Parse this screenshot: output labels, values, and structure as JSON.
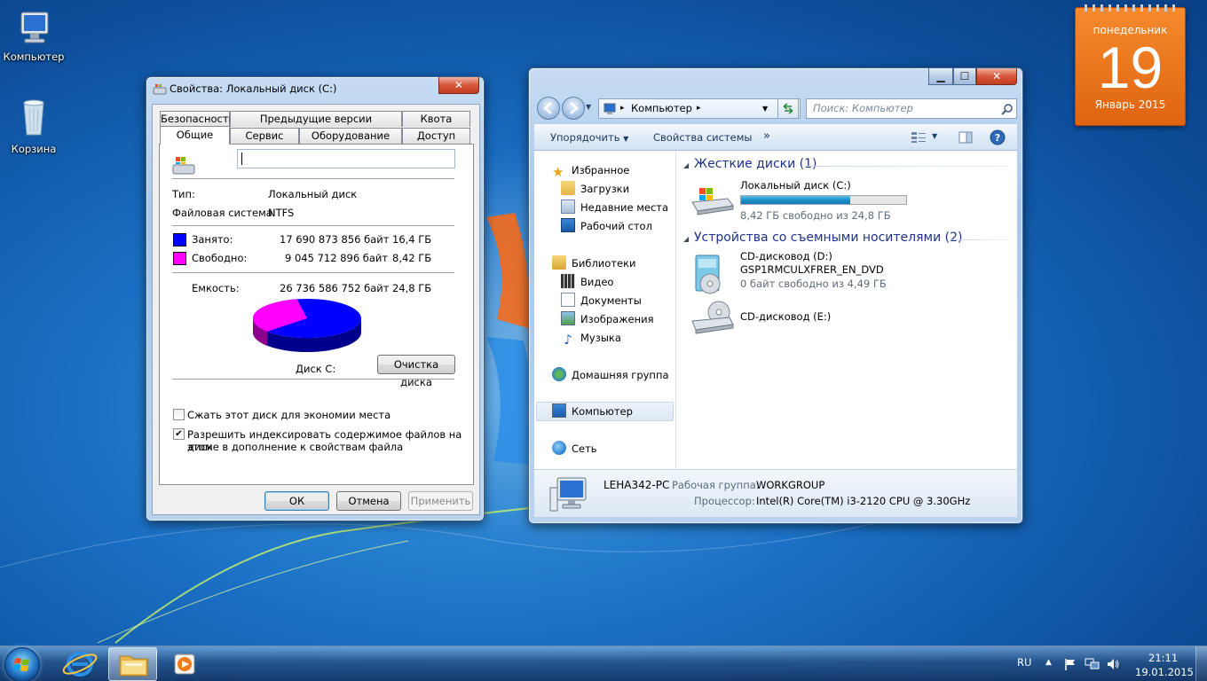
{
  "desktop": {
    "icons": [
      {
        "label": "Компьютер"
      },
      {
        "label": "Корзина"
      }
    ]
  },
  "calendar": {
    "weekday": "понедельник",
    "day": "19",
    "month_year": "Январь 2015"
  },
  "properties": {
    "title": "Свойства: Локальный диск (C:)",
    "tabs_row1": [
      "Безопасность",
      "Предыдущие версии",
      "Квота"
    ],
    "tabs_row2": [
      "Общие",
      "Сервис",
      "Оборудование",
      "Доступ"
    ],
    "active_tab": "Общие",
    "label_value": "",
    "type_label": "Тип:",
    "type_value": "Локальный диск",
    "fs_label": "Файловая система:",
    "fs_value": "NTFS",
    "used_label": "Занято:",
    "used_bytes": "17 690 873 856 байт",
    "used_gb": "16,4 ГБ",
    "free_label": "Свободно:",
    "free_bytes": "9 045 712 896 байт",
    "free_gb": "8,42 ГБ",
    "capacity_label": "Емкость:",
    "capacity_bytes": "26 736 586 752 байт",
    "capacity_gb": "24,8 ГБ",
    "disk_caption": "Диск C:",
    "cleanup_button": "Очистка диска",
    "compress_label": "Сжать этот диск для экономии места",
    "compress_checked": false,
    "index_label_1": "Разрешить индексировать содержимое файлов на этом",
    "index_label_2": "диске в дополнение к свойствам файла",
    "index_checked": true,
    "ok": "ОК",
    "cancel": "Отмена",
    "apply": "Применить",
    "used_color": "#0000ff",
    "free_color": "#ff00ff",
    "used_fraction": 0.6617
  },
  "explorer": {
    "address": "Компьютер",
    "search_placeholder": "Поиск: Компьютер",
    "cmd_organize": "Упорядочить",
    "cmd_system_props": "Свойства системы",
    "cmd_more": "»",
    "nav": {
      "favorites": "Избранное",
      "downloads": "Загрузки",
      "recent": "Недавние места",
      "desktop": "Рабочий стол",
      "libraries": "Библиотеки",
      "video": "Видео",
      "documents": "Документы",
      "images": "Изображения",
      "music": "Музыка",
      "homegroup": "Домашняя группа",
      "computer": "Компьютер",
      "network": "Сеть"
    },
    "group_hdd": "Жесткие диски (1)",
    "group_removable": "Устройства со съемными носителями (2)",
    "drive_c_name": "Локальный диск (C:)",
    "drive_c_free": "8,42 ГБ свободно из 24,8 ГБ",
    "drive_c_used_fraction": 0.6617,
    "drive_d_name": "CD-дисковод (D:)",
    "drive_d_label": "GSP1RMCULXFRER_EN_DVD",
    "drive_d_free": "0 байт свободно из 4,49 ГБ",
    "drive_e_name": "CD-дисковод (E:)",
    "pc_name": "LEHA342-PC",
    "workgroup_label": "Рабочая группа:",
    "workgroup_value": "WORKGROUP",
    "cpu_label": "Процессор:",
    "cpu_value": "Intel(R) Core(TM) i3-2120 CPU @ 3.30GHz"
  },
  "taskbar": {
    "lang": "RU",
    "time": "21:11",
    "date": "19.01.2015"
  }
}
